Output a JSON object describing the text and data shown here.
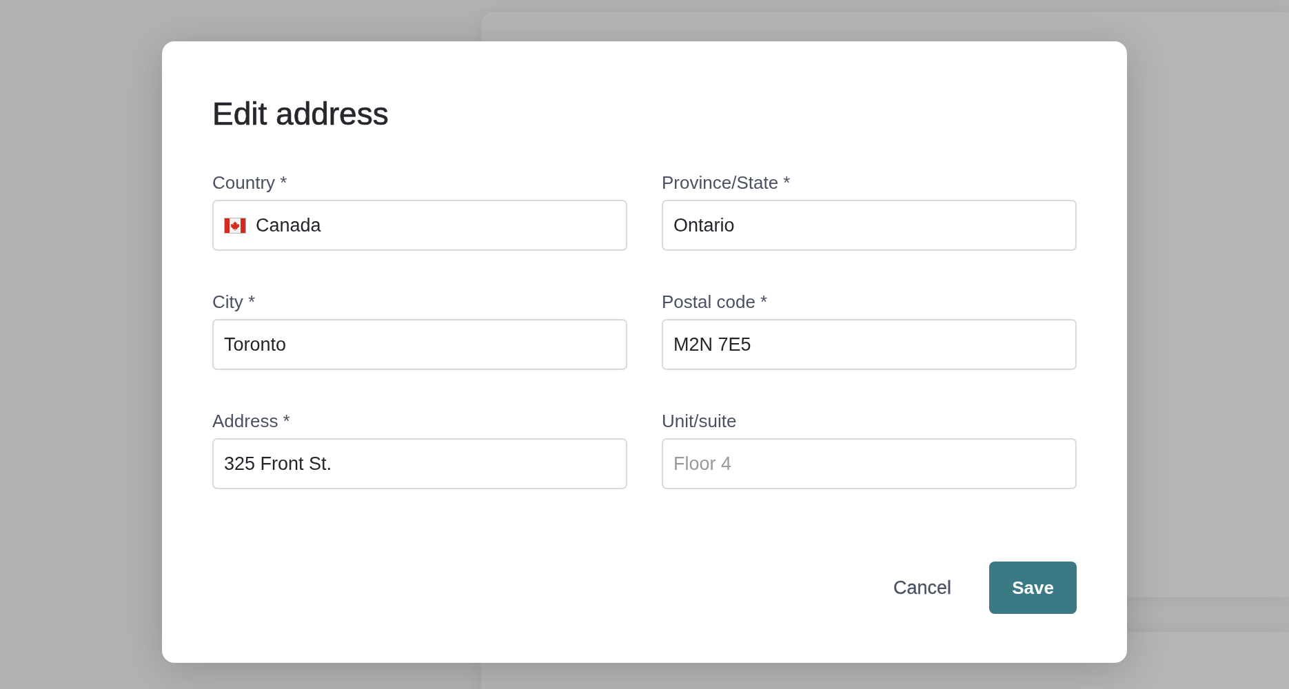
{
  "dialog": {
    "title": "Edit address",
    "fields": [
      {
        "label": "Country *",
        "kind": "country",
        "value": "Canada"
      },
      {
        "label": "Province/State *",
        "kind": "text",
        "value": "Ontario"
      },
      {
        "label": "City *",
        "kind": "text",
        "value": "Toronto"
      },
      {
        "label": "Postal code *",
        "kind": "text",
        "value": "M2N 7E5"
      },
      {
        "label": "Address *",
        "kind": "text",
        "value": "325 Front St."
      },
      {
        "label": "Unit/suite",
        "kind": "text",
        "placeholder": "Floor 4"
      }
    ],
    "buttons": [
      {
        "label": "Cancel",
        "kind": "secondary"
      },
      {
        "label": "Save",
        "kind": "primary"
      }
    ]
  }
}
